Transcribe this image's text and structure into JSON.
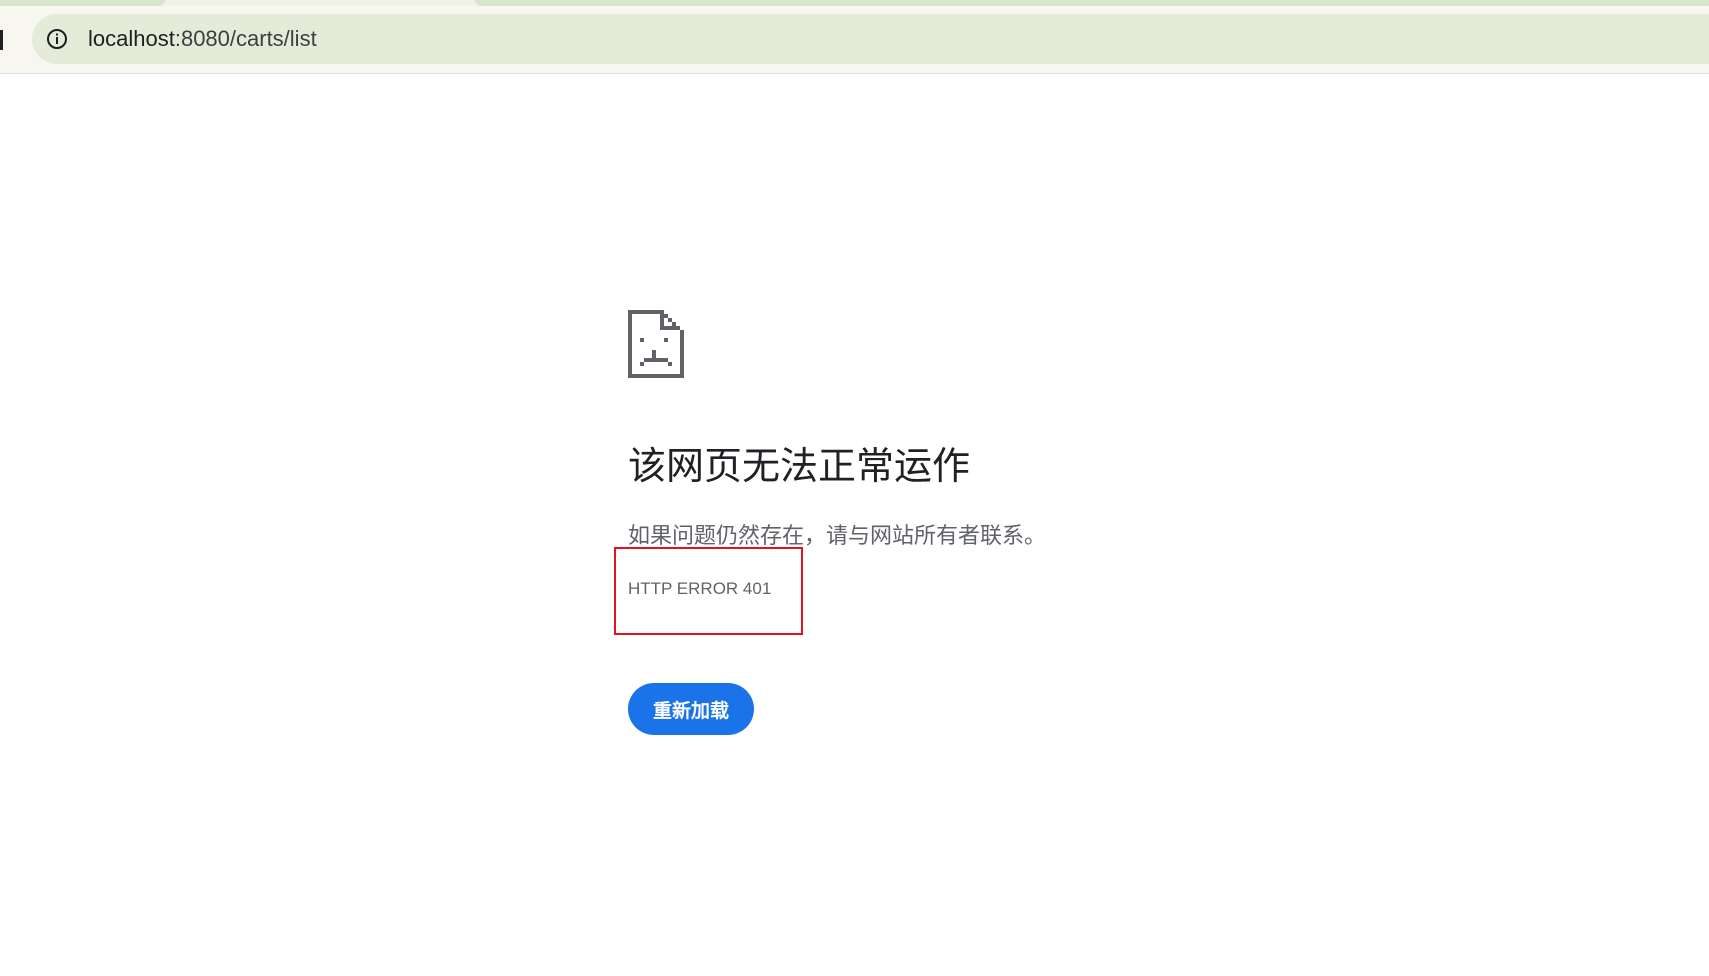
{
  "address_bar": {
    "url_host": "localhost",
    "url_rest": ":8080/carts/list",
    "info_icon": "info-icon"
  },
  "error_page": {
    "icon": "sad-page-icon",
    "title": "该网页无法正常运作",
    "message": "如果问题仍然存在，请与网站所有者联系。",
    "error_code": "HTTP ERROR 401",
    "reload_label": "重新加载"
  },
  "colors": {
    "reload_button": "#1a73e8",
    "highlight_box": "#e1141e",
    "omnibox": "#e4ebd8"
  }
}
